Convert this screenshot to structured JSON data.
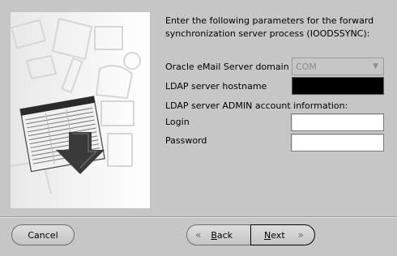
{
  "intro_text": "Enter the following parameters for the forward synchronization server process (IOODSSYNC):",
  "fields": {
    "domain_label": "Oracle eMail Server domain",
    "domain_value": "COM",
    "ldap_host_label": "LDAP server hostname",
    "ldap_host_value": "",
    "admin_section_label": "LDAP server ADMIN account information:",
    "login_label": "Login",
    "login_value": "",
    "password_label": "Password",
    "password_value": ""
  },
  "buttons": {
    "cancel": "Cancel",
    "back_first": "B",
    "back_rest": "ack",
    "next_first": "N",
    "next_rest": "ext"
  },
  "icons": {
    "back": "chevron-double-left-icon",
    "next": "chevron-double-right-icon"
  },
  "colors": {
    "background": "#c6c6c6",
    "field": "#ffffff",
    "hostname_field": "#000000"
  }
}
